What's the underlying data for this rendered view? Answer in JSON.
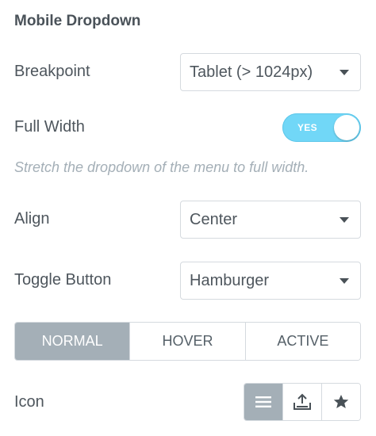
{
  "section": {
    "title": "Mobile Dropdown"
  },
  "breakpoint": {
    "label": "Breakpoint",
    "value": "Tablet (> 1024px)"
  },
  "full_width": {
    "label": "Full Width",
    "toggle_text": "YES",
    "enabled": true,
    "description": "Stretch the dropdown of the menu to full width."
  },
  "align": {
    "label": "Align",
    "value": "Center"
  },
  "toggle_button": {
    "label": "Toggle Button",
    "value": "Hamburger"
  },
  "state_tabs": [
    {
      "label": "NORMAL",
      "active": true
    },
    {
      "label": "HOVER",
      "active": false
    },
    {
      "label": "ACTIVE",
      "active": false
    }
  ],
  "icon": {
    "label": "Icon",
    "options": [
      {
        "icon": "hamburger-icon",
        "selected": true
      },
      {
        "icon": "upload-icon",
        "selected": false
      },
      {
        "icon": "star-icon",
        "selected": false
      }
    ]
  },
  "colors": {
    "toggle_on": "#71d7f7",
    "active_tab": "#a4afb7",
    "text": "#4e565d",
    "hint": "#a4afb7"
  }
}
